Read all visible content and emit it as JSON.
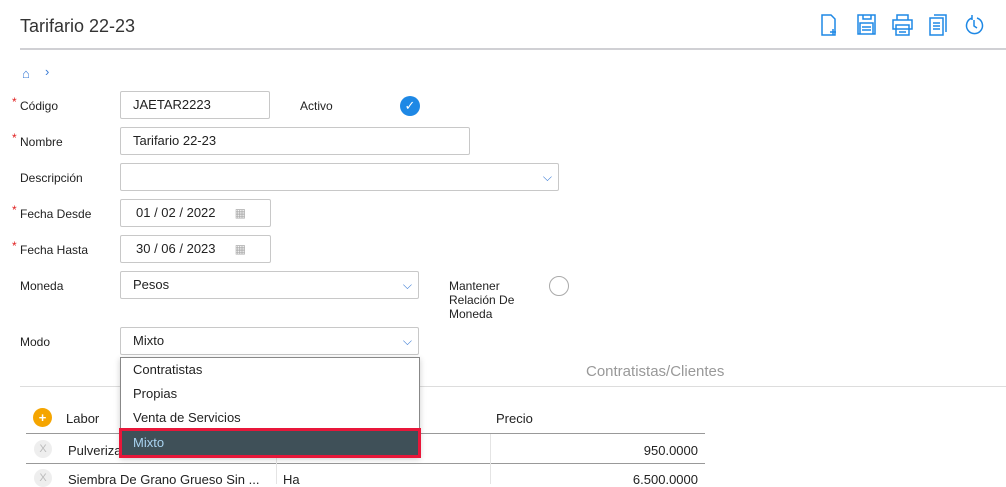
{
  "header": {
    "title": "Tarifario 22-23"
  },
  "toolbar": {
    "icons": [
      "new-document-icon",
      "save-icon",
      "print-icon",
      "copy-icon",
      "history-icon"
    ]
  },
  "form": {
    "codigo_label": "Código",
    "codigo": "JAETAR2223",
    "activo_label": "Activo",
    "activo": true,
    "nombre_label": "Nombre",
    "nombre": "Tarifario 22-23",
    "descripcion_label": "Descripción",
    "descripcion": "",
    "desde_label": "Fecha Desde",
    "desde": "01 / 02 / 2022",
    "hasta_label": "Fecha Hasta",
    "hasta": "30 / 06 / 2023",
    "moneda_label": "Moneda",
    "moneda": "Pesos",
    "mantener_label": "Mantener Relación De Moneda",
    "modo_label": "Modo",
    "modo": "Mixto"
  },
  "dropdown": {
    "options": [
      "Contratistas",
      "Propias",
      "Venta de Servicios",
      "Mixto"
    ],
    "selected": "Mixto"
  },
  "section": {
    "title": "Contratistas/Clientes"
  },
  "table": {
    "headers": [
      "Labor",
      "",
      "Precio"
    ],
    "rows": [
      {
        "labor": "Pulveriza",
        "unidad": "",
        "precio": "950.0000"
      },
      {
        "labor": "Siembra De Grano Grueso Sin ...",
        "unidad": "Ha",
        "precio": "6.500.0000"
      }
    ]
  }
}
